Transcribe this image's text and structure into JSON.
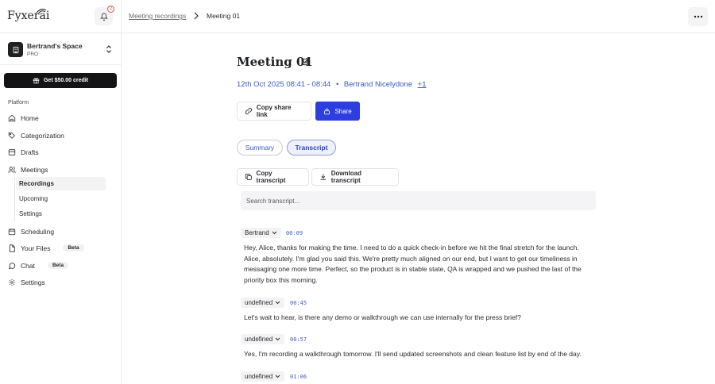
{
  "sidebar": {
    "logo": "Fyxer",
    "logo_suffix": "ai",
    "notifications_count": "2",
    "space": {
      "name": "Bertrand's Space",
      "plan": "PRO"
    },
    "credit_button": "Get $50.00 credit",
    "section_label": "Platform",
    "nav": {
      "home": "Home",
      "categorization": "Categorization",
      "drafts": "Drafts",
      "meetings": "Meetings",
      "recordings": "Recordings",
      "upcoming": "Upcoming",
      "meeting_settings": "Settings",
      "scheduling": "Scheduling",
      "your_files": "Your Files",
      "chat": "Chat",
      "settings": "Settings"
    },
    "beta_label": "Beta"
  },
  "breadcrumb": {
    "parent": "Meeting recordings",
    "current": "Meeting 01"
  },
  "meeting": {
    "title": "Meeting 01",
    "date": "12th Oct 2025 08:41 - 08:44",
    "separator": "•",
    "attendee": "Bertrand Nicelydone",
    "extra_attendees": "+1"
  },
  "actions": {
    "copy_link": "Copy share link",
    "share": "Share"
  },
  "tabs": {
    "summary": "Summary",
    "transcript": "Transcript"
  },
  "transcript_actions": {
    "copy": "Copy transcript",
    "download": "Download transcript"
  },
  "search": {
    "placeholder": "Search transcript..."
  },
  "transcript": [
    {
      "speaker": "Bertrand",
      "time": "00:09",
      "text": "Hey, Alice, thanks for making the time. I need to do a quick check-in before we hit the final stretch for the launch. Alice, absolutely. I'm glad you said this. We're pretty much aligned on our end, but I want to get our timeliness in messaging one more time. Perfect, so the product is in stable state, QA is wrapped and we pushed the last of the priority box this morning."
    },
    {
      "speaker": "undefined",
      "time": "00:45",
      "text": "Let's wait to hear, is there any demo or walkthrough we can use internally for the press brief?"
    },
    {
      "speaker": "undefined",
      "time": "00:57",
      "text": "Yes, I'm recording a walkthrough tomorrow. I'll send updated screenshots and clean feature list by end of the day."
    },
    {
      "speaker": "undefined",
      "time": "01:06",
      "text": ""
    }
  ],
  "colors": {
    "primary": "#2d3ee0",
    "link": "#3a5bc4",
    "dark": "#141417"
  }
}
